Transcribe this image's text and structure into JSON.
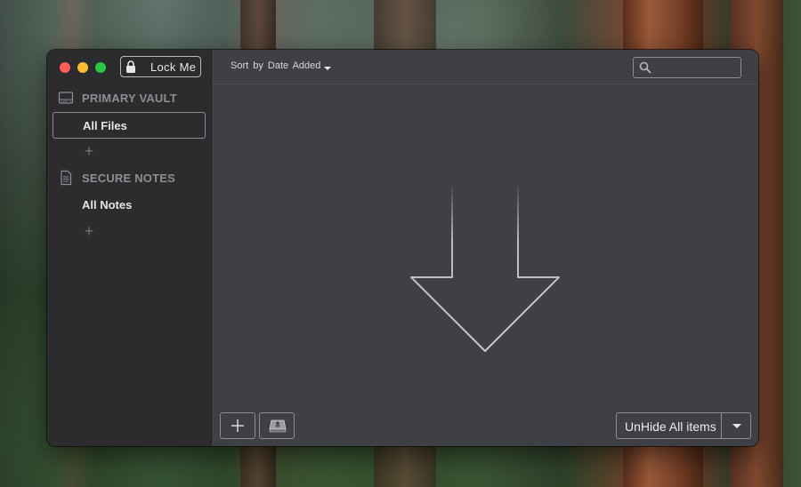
{
  "window": {
    "lock_button_label": "Lock Me",
    "lock_icon": "lock-icon"
  },
  "sidebar": {
    "sections": [
      {
        "header": "PRIMARY VAULT",
        "icon": "hard-drive-icon",
        "items": [
          {
            "label": "All Files",
            "selected": true
          }
        ],
        "add_label": "+"
      },
      {
        "header": "SECURE NOTES",
        "icon": "document-icon",
        "items": [
          {
            "label": "All Notes",
            "selected": false
          }
        ],
        "add_label": "+"
      }
    ]
  },
  "toolbar": {
    "sort_label": "Sort by Date Added",
    "search": {
      "value": "",
      "placeholder": "",
      "icon": "search-icon"
    }
  },
  "main": {
    "drop_zone_icon": "down-arrow-icon"
  },
  "footer": {
    "add_button_icon": "plus-icon",
    "drive_button_icon": "drive-icon",
    "unhide_label": "UnHide All items"
  },
  "colors": {
    "sidebar_bg": "#2c2c2e",
    "main_bg": "#3f4045",
    "close": "#ff5f57",
    "minimize": "#febc2e",
    "zoom": "#28c840"
  }
}
